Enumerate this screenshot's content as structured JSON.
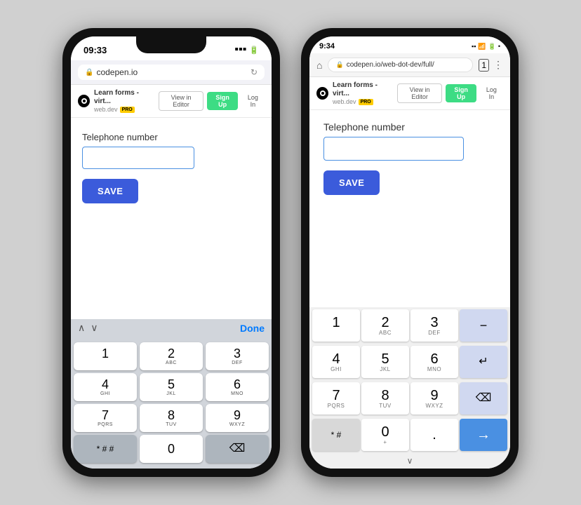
{
  "left_phone": {
    "status_time": "09:33",
    "url": "codepen.io",
    "cp_title": "Learn forms - virt...",
    "cp_domain": "web.dev",
    "pro_label": "PRO",
    "view_editor": "View in Editor",
    "sign_up": "Sign Up",
    "log_in": "Log In",
    "form_label": "Telephone number",
    "save_button": "SAVE",
    "kb_done": "Done",
    "keyboard": {
      "row1": [
        {
          "main": "1",
          "sub": ""
        },
        {
          "main": "2",
          "sub": "ABC"
        },
        {
          "main": "3",
          "sub": "DEF"
        }
      ],
      "row2": [
        {
          "main": "4",
          "sub": "GHI"
        },
        {
          "main": "5",
          "sub": "JKL"
        },
        {
          "main": "6",
          "sub": "MNO"
        }
      ],
      "row3": [
        {
          "main": "7",
          "sub": "PQRS"
        },
        {
          "main": "8",
          "sub": "TUV"
        },
        {
          "main": "9",
          "sub": "WXYZ"
        }
      ],
      "row4_left": "* # #",
      "row4_mid": "0",
      "row4_right": "⌫"
    }
  },
  "right_phone": {
    "status_time": "9:34",
    "url": "codepen.io/web-dot-dev/full/",
    "cp_title": "Learn forms - virt...",
    "cp_domain": "web.dev",
    "pro_label": "PRO",
    "view_editor": "View in Editor",
    "sign_up": "Sign Up",
    "log_in": "Log In",
    "form_label": "Telephone number",
    "save_button": "SAVE",
    "keyboard": {
      "row1": [
        {
          "main": "1",
          "sub": ""
        },
        {
          "main": "2",
          "sub": "ABC"
        },
        {
          "main": "3",
          "sub": "DEF"
        },
        {
          "main": "−",
          "sub": "",
          "dark": true
        }
      ],
      "row2": [
        {
          "main": "4",
          "sub": "GHI"
        },
        {
          "main": "5",
          "sub": "JKL"
        },
        {
          "main": "6",
          "sub": "MNO"
        },
        {
          "main": "↵",
          "sub": "",
          "dark": true
        }
      ],
      "row3": [
        {
          "main": "7",
          "sub": "PQRS"
        },
        {
          "main": "8",
          "sub": "TUV"
        },
        {
          "main": "9",
          "sub": "WXYZ"
        },
        {
          "main": "⌫",
          "sub": "",
          "dark": true
        }
      ],
      "row4": [
        {
          "main": "* #",
          "sub": "",
          "dark": true
        },
        {
          "main": "0",
          "sub": "+"
        },
        {
          "main": ".",
          "sub": ""
        },
        {
          "main": "→",
          "sub": "",
          "blue": true
        }
      ]
    }
  }
}
